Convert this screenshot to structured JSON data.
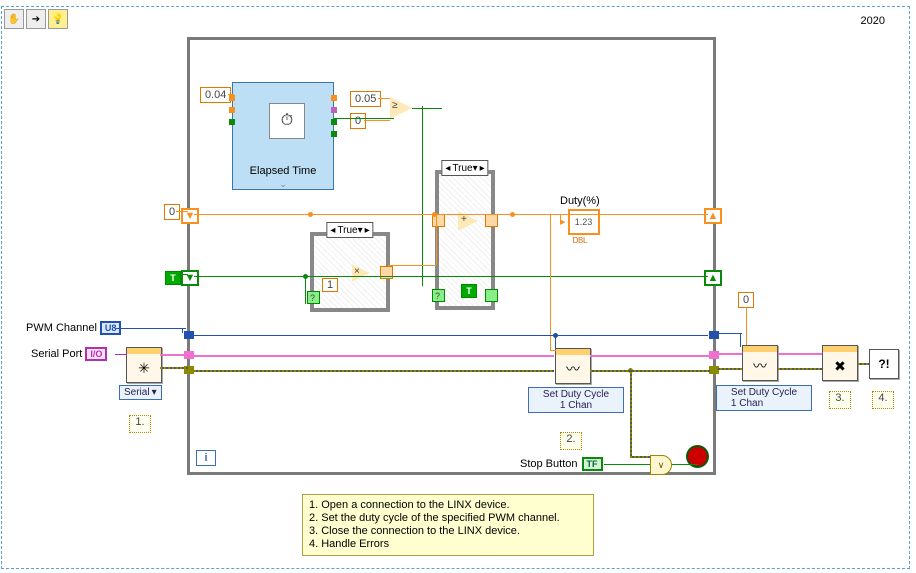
{
  "toolbar": {
    "year": "2020"
  },
  "constants": {
    "timeTarget": "0.04",
    "limitHigh": "0.05",
    "limitLow": "0",
    "init_sr_orange": "0",
    "inner_true_const": "1",
    "close_zero": "0"
  },
  "elapsed": {
    "label": "Elapsed Time"
  },
  "caseInner": {
    "selector": "True"
  },
  "caseOuter": {
    "selector": "True"
  },
  "indicator_duty": {
    "label": "Duty(%)",
    "value": "1.23",
    "dtype": "DBL"
  },
  "controls": {
    "pwmChannel": {
      "label": "PWM Channel",
      "dtype": "U8"
    },
    "serialPort": {
      "label": "Serial Port",
      "dtype": "I/O"
    },
    "stop": {
      "label": "Stop Button",
      "dtype": "TF"
    }
  },
  "linx": {
    "open_poly": "Serial",
    "set1_poly": "Set Duty Cycle\n1 Chan",
    "set2_poly": "Set Duty Cycle\n1 Chan"
  },
  "ann": {
    "a1": "1.",
    "a2": "2.",
    "a3": "3.",
    "a4": "4."
  },
  "help": {
    "l1": "1. Open a connection to the LINX device.",
    "l2": "2. Set the duty cycle of the specified PWM channel.",
    "l3": "3. Close the connection to the LINX device.",
    "l4": "4. Handle Errors"
  }
}
